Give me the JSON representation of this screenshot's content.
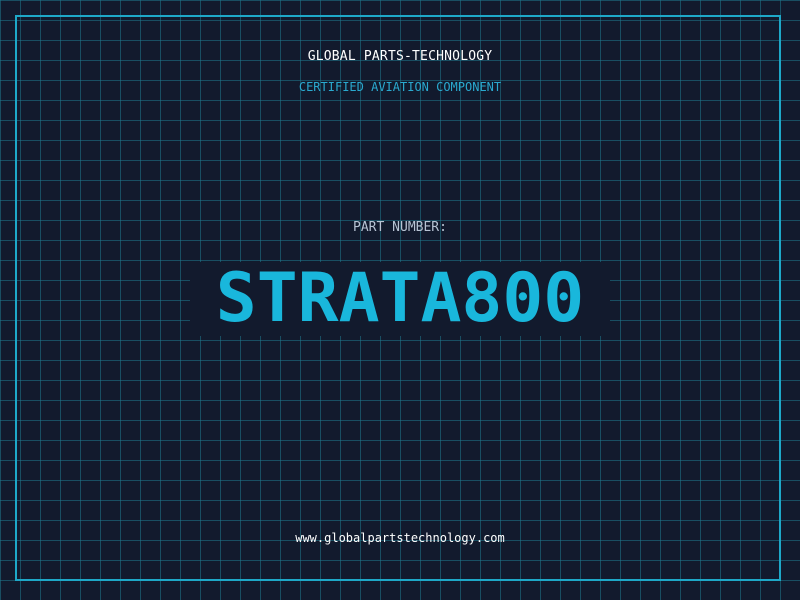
{
  "header": {
    "company": "GLOBAL PARTS-TECHNOLOGY",
    "tagline": "CERTIFIED AVIATION COMPONENT"
  },
  "part": {
    "label": "PART NUMBER:",
    "number": "STRATA800"
  },
  "footer": {
    "website": "www.globalpartstechnology.com"
  },
  "colors": {
    "background": "#121a2d",
    "grid": "#1f788e",
    "accent": "#1ea8c8",
    "part_number": "#19b7dc",
    "text": "#ffffff"
  }
}
